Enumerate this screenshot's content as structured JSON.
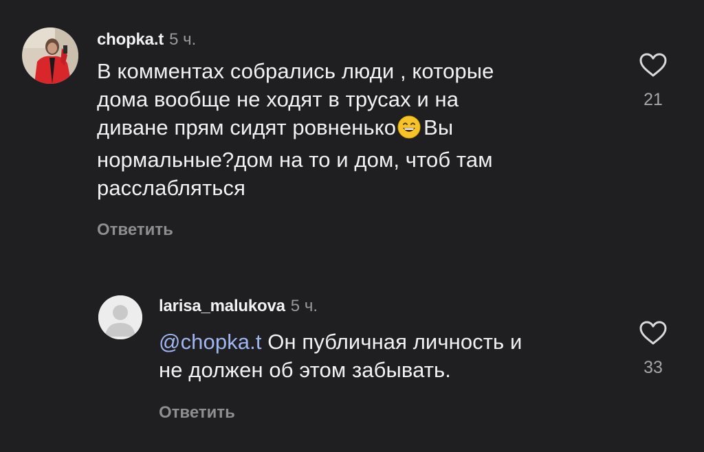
{
  "comments": [
    {
      "username": "chopka.t",
      "time": "5 ч.",
      "text_lines": [
        "В комментах собрались люди , которые",
        "дома вообще не ходят в трусах и на",
        "диване прям сидят ровненько",
        "Вы",
        "нормальные?дом на то и дом, чтоб там",
        "расслабляться"
      ],
      "emoji": "grinning-face-with-smiling-eyes",
      "reply_label": "Ответить",
      "likes": "21",
      "avatar": "profile-photo"
    },
    {
      "username": "larisa_malukova",
      "time": "5 ч.",
      "mention": "@chopka.t",
      "text_lines": [
        "Он публичная личность и",
        "не должен об этом забывать."
      ],
      "reply_label": "Ответить",
      "likes": "33",
      "avatar": "default-avatar"
    }
  ],
  "colors": {
    "background": "#1f1f21",
    "text": "#f2f2f2",
    "muted": "#9a9a9e",
    "mention": "#9fb6f0",
    "heart": "#d9d9d9"
  }
}
